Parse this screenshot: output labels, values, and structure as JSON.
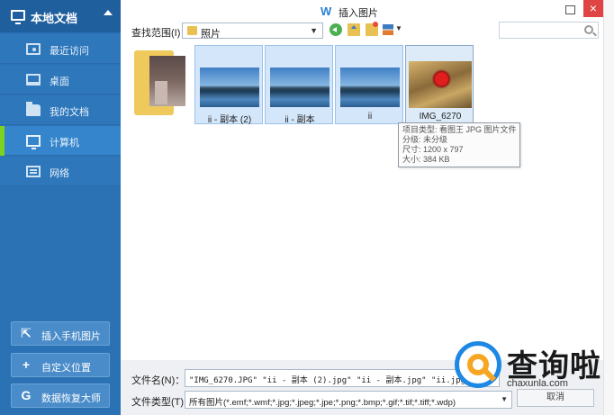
{
  "sidebar": {
    "title": "本地文档",
    "items": [
      {
        "label": "最近访问",
        "icon": "recent-icon"
      },
      {
        "label": "桌面",
        "icon": "desktop-icon"
      },
      {
        "label": "我的文档",
        "icon": "documents-icon"
      },
      {
        "label": "计算机",
        "icon": "computer-icon",
        "active": true
      },
      {
        "label": "网络",
        "icon": "network-icon"
      }
    ],
    "buttons": [
      {
        "label": "插入手机图片",
        "icon": "phone-import-icon"
      },
      {
        "label": "自定义位置",
        "icon": "plus-icon"
      },
      {
        "label": "数据恢复大师",
        "icon": "recovery-icon"
      }
    ]
  },
  "dialog": {
    "logo": "W",
    "title": "插入图片",
    "close": "×",
    "look_in_label": "查找范围(I)：",
    "look_in_value": "照片",
    "search_placeholder": ""
  },
  "files": [
    {
      "label": "ii - 副本 (2)"
    },
    {
      "label": "ii - 副本"
    },
    {
      "label": "ii"
    },
    {
      "label": "IMG_6270"
    }
  ],
  "tooltip": {
    "type": "项目类型: 看图王 JPG 图片文件",
    "rating": "分级: 未分级",
    "size_dims": "尺寸: 1200 x 797",
    "file_size": "大小: 384 KB"
  },
  "bottom": {
    "filename_label": "文件名(N)：",
    "filename_value": "\"IMG_6270.JPG\" \"ii - 副本 (2).jpg\" \"ii - 副本.jpg\" \"ii.jpg\"",
    "filetype_label": "文件类型(T)：",
    "filetype_value": "所有图片(*.emf;*.wmf;*.jpg;*.jpeg;*.jpe;*.png;*.bmp;*.gif;*.tif;*.tiff;*.wdp)",
    "open_label": "取消"
  },
  "watermark": {
    "text": "查询啦",
    "url": "chaxunla.com"
  },
  "colors": {
    "sidebar": "#2b72b4",
    "sidebar_active_marker": "#7ed321",
    "selection": "#d4e6fa",
    "close": "#e04343"
  }
}
